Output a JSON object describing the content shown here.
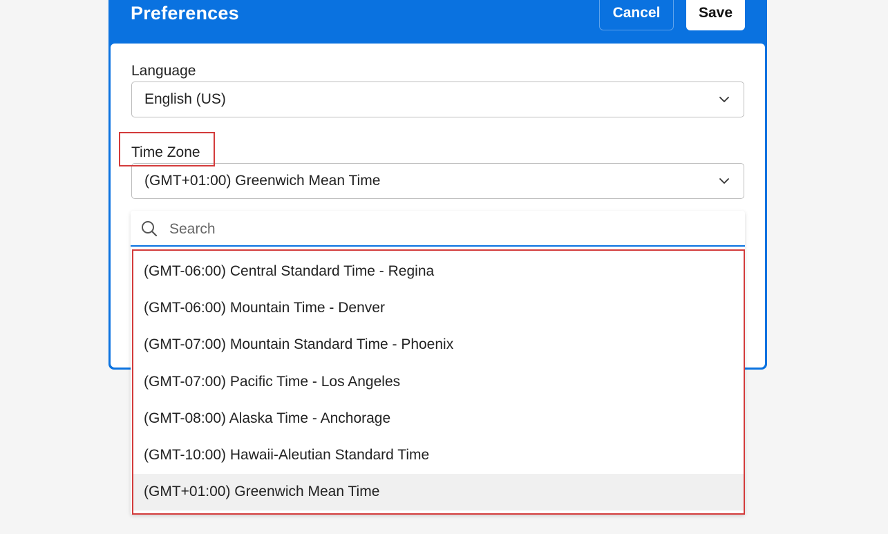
{
  "header": {
    "title": "Preferences",
    "cancel_label": "Cancel",
    "save_label": "Save"
  },
  "language": {
    "label": "Language",
    "value": "English (US)"
  },
  "timezone": {
    "label": "Time Zone",
    "value": "(GMT+01:00) Greenwich Mean Time"
  },
  "dropdown": {
    "search_placeholder": "Search",
    "options": [
      {
        "label": "(GMT-06:00) Central Standard Time - Regina",
        "selected": false
      },
      {
        "label": "(GMT-06:00) Mountain Time - Denver",
        "selected": false
      },
      {
        "label": "(GMT-07:00) Mountain Standard Time - Phoenix",
        "selected": false
      },
      {
        "label": "(GMT-07:00) Pacific Time - Los Angeles",
        "selected": false
      },
      {
        "label": "(GMT-08:00) Alaska Time - Anchorage",
        "selected": false
      },
      {
        "label": "(GMT-10:00) Hawaii-Aleutian Standard Time",
        "selected": false
      },
      {
        "label": "(GMT+01:00) Greenwich Mean Time",
        "selected": true
      }
    ]
  },
  "colors": {
    "brand": "#0a72e0",
    "highlight": "#d33b3b",
    "selected_bg": "#f0f0f0"
  }
}
